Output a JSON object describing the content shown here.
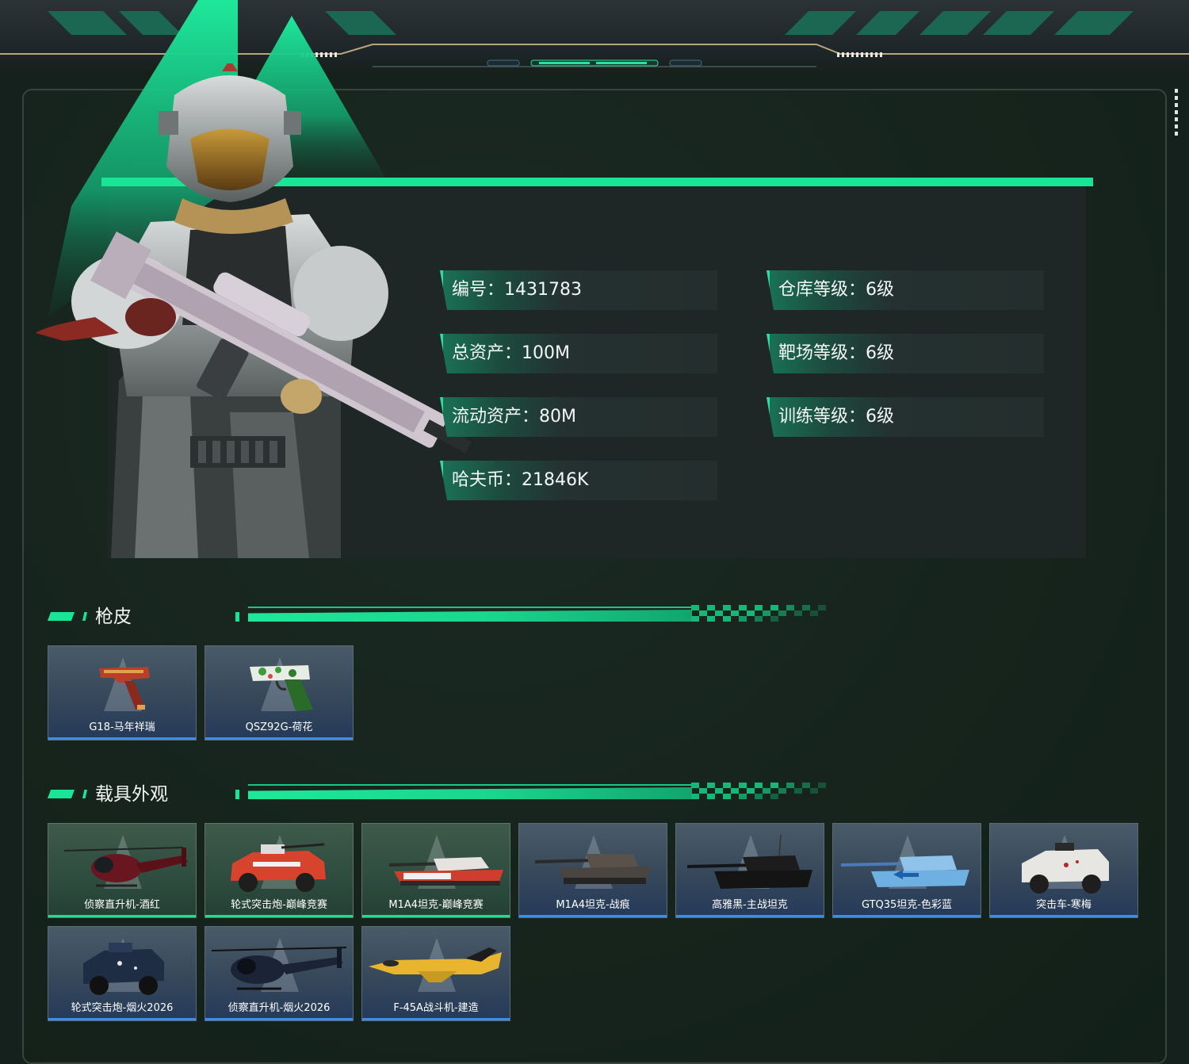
{
  "stats": {
    "id": "编号：1431783",
    "total_assets": "总资产：100M",
    "liquid_assets": "流动资产：80M",
    "hafcoin": "哈夫币：21846K",
    "warehouse_level": "仓库等级：6级",
    "range_level": "靶场等级：6级",
    "training_level": "训练等级：6级"
  },
  "sections": {
    "gun_skins": {
      "title": "枪皮",
      "items": [
        {
          "label": "G18-马年祥瑞",
          "icon": "pistol-red-gold-icon"
        },
        {
          "label": "QSZ92G-荷花",
          "icon": "pistol-green-floral-icon"
        }
      ]
    },
    "vehicle_skins": {
      "title": "载具外观",
      "items": [
        {
          "label": "侦察直升机-酒红",
          "icon": "helicopter-icon",
          "theme": "green"
        },
        {
          "label": "轮式突击炮-巅峰竞赛",
          "icon": "armored-car-icon",
          "theme": "green"
        },
        {
          "label": "M1A4坦克-巅峰竞赛",
          "icon": "tank-icon",
          "theme": "green"
        },
        {
          "label": "M1A4坦克-战痕",
          "icon": "tank-icon",
          "theme": "blue"
        },
        {
          "label": "高雅黑-主战坦克",
          "icon": "tank-icon",
          "theme": "blue"
        },
        {
          "label": "GTQ35坦克-色彩蓝",
          "icon": "tank-icon",
          "theme": "blue"
        },
        {
          "label": "突击车-寒梅",
          "icon": "assault-vehicle-icon",
          "theme": "blue"
        },
        {
          "label": "轮式突击炮-烟火2026",
          "icon": "armored-car-icon",
          "theme": "blue"
        },
        {
          "label": "侦察直升机-烟火2026",
          "icon": "helicopter-icon",
          "theme": "blue"
        },
        {
          "label": "F-45A战斗机-建造",
          "icon": "fighter-jet-icon",
          "theme": "blue"
        }
      ]
    }
  },
  "colors": {
    "accent": "#19e596",
    "card_blue_edge": "#3b8ee2",
    "card_green_edge": "#29d98f"
  }
}
